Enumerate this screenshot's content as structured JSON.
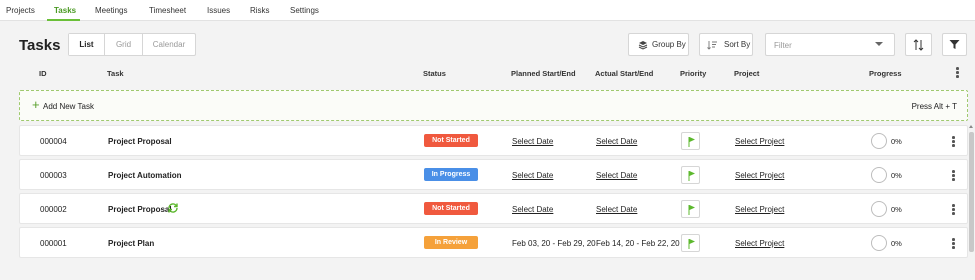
{
  "nav": {
    "tabs": [
      {
        "label": "Projects"
      },
      {
        "label": "Tasks",
        "active": true
      },
      {
        "label": "Meetings"
      },
      {
        "label": "Timesheet"
      },
      {
        "label": "Issues"
      },
      {
        "label": "Risks"
      },
      {
        "label": "Settings"
      }
    ]
  },
  "page": {
    "title": "Tasks",
    "views": [
      "List",
      "Grid",
      "Calendar"
    ],
    "active_view": "List"
  },
  "toolbar": {
    "group_by_label": "Group By",
    "sort_by_label": "Sort By",
    "filter_placeholder": "Filter"
  },
  "columns": {
    "id": "ID",
    "task": "Task",
    "status": "Status",
    "planned": "Planned Start/End",
    "actual": "Actual Start/End",
    "priority": "Priority",
    "project": "Project",
    "progress": "Progress"
  },
  "add_task": {
    "label": "Add New Task",
    "shortcut": "Press Alt + T"
  },
  "rows": [
    {
      "id": "000004",
      "task": "Project Proposal",
      "recurring": false,
      "status": "Not Started",
      "planned": "Select Date",
      "actual": "Select Date",
      "project": "Select Project",
      "progress": "0%"
    },
    {
      "id": "000003",
      "task": "Project Automation",
      "recurring": false,
      "status": "In Progress",
      "planned": "Select Date",
      "actual": "Select Date",
      "project": "Select Project",
      "progress": "0%"
    },
    {
      "id": "000002",
      "task": "Project Proposal",
      "recurring": true,
      "status": "Not Started",
      "planned": "Select Date",
      "actual": "Select Date",
      "project": "Select Project",
      "progress": "0%"
    },
    {
      "id": "000001",
      "task": "Project Plan",
      "recurring": false,
      "status": "In Review",
      "planned": "Feb 03, 20 - Feb 29, 20",
      "actual": "Feb 14, 20 - Feb 22, 20",
      "project": "Select Project",
      "progress": "0%"
    }
  ],
  "colors": {
    "accent": "#6abf38",
    "not_started": "#f0593e",
    "in_progress": "#4a8fe7",
    "in_review": "#f5a13a",
    "priority_flag": "#5cb82d"
  },
  "icons": [
    "group-by-icon",
    "sort-by-icon",
    "sort-toggle-icon",
    "funnel-icon",
    "flag-icon",
    "recurring-icon",
    "kebab-icon"
  ]
}
